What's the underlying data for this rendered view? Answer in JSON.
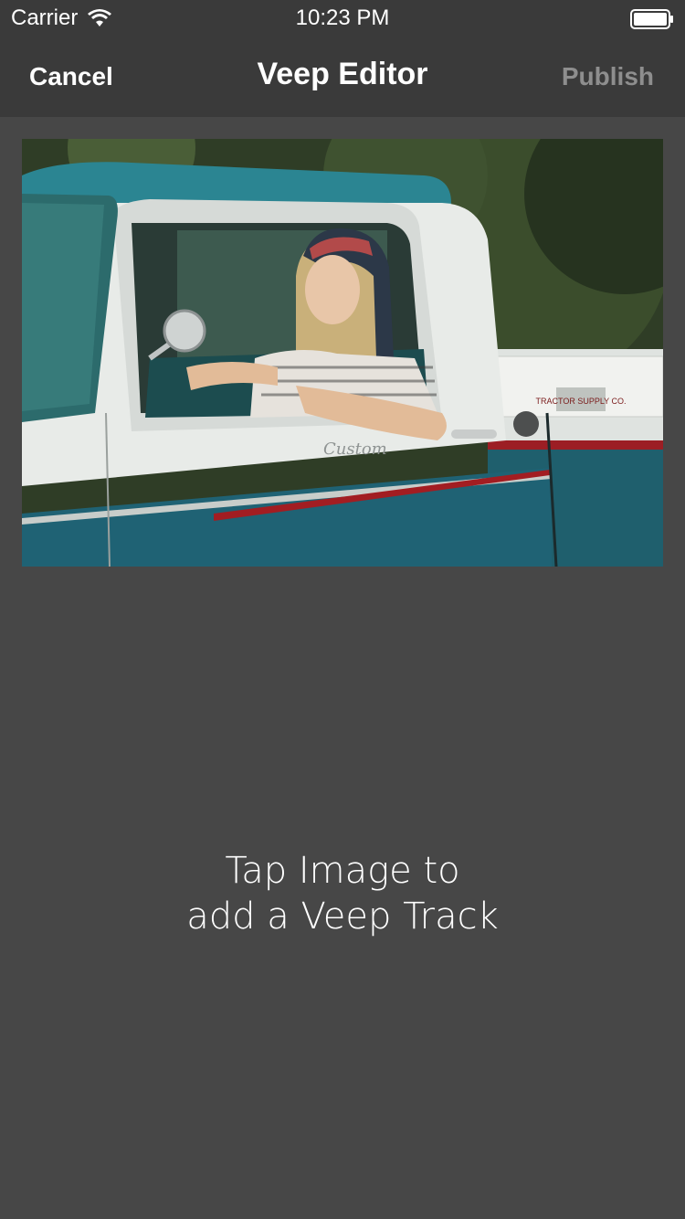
{
  "status_bar": {
    "carrier": "Carrier",
    "time": "10:23 PM",
    "icons": [
      "wifi-icon",
      "battery-icon"
    ]
  },
  "nav": {
    "cancel_label": "Cancel",
    "title": "Veep Editor",
    "publish_label": "Publish"
  },
  "photo": {
    "description_icon": "photo-truck-woman",
    "emblem_text": "TRACTOR SUPPLY CO.",
    "script_text": "Custom"
  },
  "hint": {
    "line1": "Tap Image to",
    "line2": "add a Veep Track"
  },
  "colors": {
    "background": "#474747",
    "bar": "#3a3a3a",
    "title": "#ffffff",
    "publish_disabled": "#8e8e8e",
    "truck_teal": "#2d7f89",
    "truck_white": "#e9ecea"
  }
}
